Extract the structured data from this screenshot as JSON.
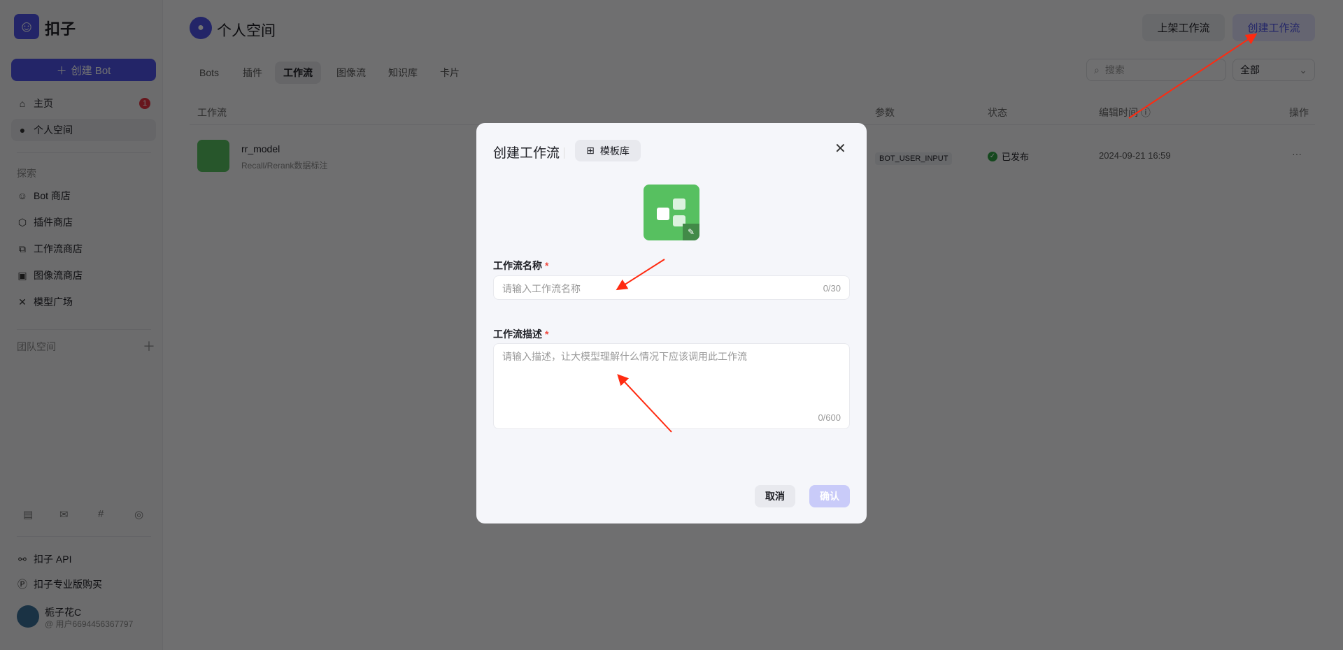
{
  "sidebar": {
    "brand": "扣子",
    "create_bot": "创建 Bot",
    "items": [
      {
        "label": "主页",
        "icon": "home-icon",
        "badge": "1"
      },
      {
        "label": "个人空间",
        "icon": "user-icon"
      }
    ],
    "explore_label": "探索",
    "explore": [
      {
        "label": "Bot 商店",
        "icon": "bot-icon"
      },
      {
        "label": "插件商店",
        "icon": "cube-icon"
      },
      {
        "label": "工作流商店",
        "icon": "workflow-icon"
      },
      {
        "label": "图像流商店",
        "icon": "image-icon"
      },
      {
        "label": "模型广场",
        "icon": "model-icon"
      }
    ],
    "team_label": "团队空间",
    "api": "扣子 API",
    "pro": "扣子专业版购买",
    "user": {
      "name": "栀子花C",
      "id": "@ 用户6694456367797"
    }
  },
  "header": {
    "title": "个人空间",
    "publish_btn": "上架工作流",
    "create_btn": "创建工作流"
  },
  "tabs": [
    "Bots",
    "插件",
    "工作流",
    "图像流",
    "知识库",
    "卡片"
  ],
  "active_tab": "工作流",
  "search": {
    "placeholder": "搜索"
  },
  "filter": {
    "value": "全部"
  },
  "table": {
    "headers": [
      "工作流",
      "参数",
      "状态",
      "编辑时间",
      "操作"
    ],
    "rows": [
      {
        "name": "rr_model",
        "desc": "Recall/Rerank数据标注",
        "param": "BOT_USER_INPUT",
        "status": "已发布",
        "time": "2024-09-21 16:59",
        "actions": "···"
      }
    ]
  },
  "modal": {
    "title": "创建工作流",
    "template_btn": "模板库",
    "name_label": "工作流名称",
    "name_placeholder": "请输入工作流名称",
    "name_count": "0/30",
    "desc_label": "工作流描述",
    "desc_placeholder": "请输入描述，让大模型理解什么情况下应该调用此工作流",
    "desc_count": "0/600",
    "required": "*",
    "cancel": "取消",
    "confirm": "确认"
  },
  "colors": {
    "brand": "#4d53e8",
    "icon_green": "#57c060",
    "annotation_arrow": "#ff2a10",
    "status_green": "#2ea043"
  }
}
